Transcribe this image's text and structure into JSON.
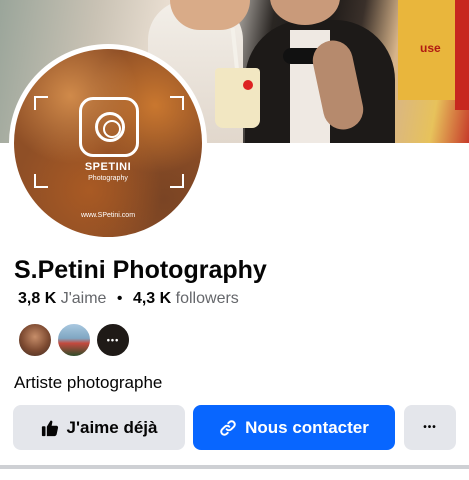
{
  "cover": {
    "sign_text": "use"
  },
  "avatar": {
    "brand": "SPETINI",
    "subtitle": "Photography",
    "url": "www.SPetini.com"
  },
  "page": {
    "name": "S.Petini Photography",
    "likes_count": "3,8 K",
    "likes_label": "J'aime",
    "separator": "•",
    "followers_count": "4,3 K",
    "followers_label": "followers",
    "more_followers_glyph": "•••",
    "category": "Artiste photographe"
  },
  "actions": {
    "like_label": "J'aime déjà",
    "like_icon": "thumbs-up-icon",
    "contact_label": "Nous contacter",
    "contact_icon": "link-icon",
    "more_label": "•••"
  },
  "colors": {
    "primary": "#0866ff",
    "secondary_button": "#e4e6eb",
    "text": "#050505",
    "muted": "#65676b"
  }
}
